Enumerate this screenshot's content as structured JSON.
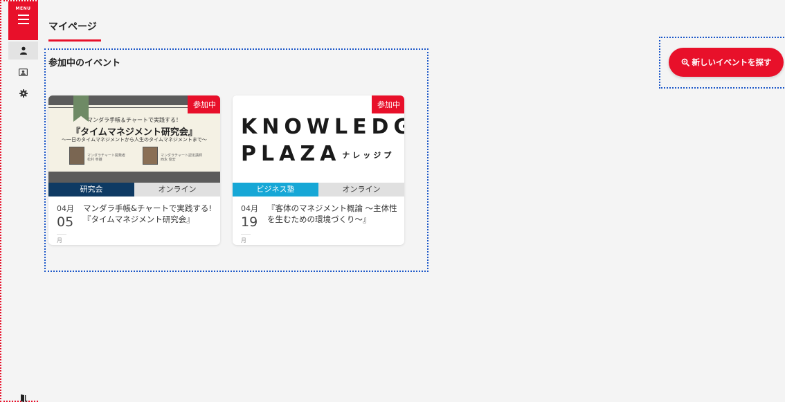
{
  "sidebar": {
    "menu_label": "MENU",
    "items": [
      {
        "icon": "user-icon"
      },
      {
        "icon": "id-card-icon"
      },
      {
        "icon": "gear-icon"
      }
    ],
    "bottom_icon": "logout-door-icon"
  },
  "header": {
    "title": "マイページ"
  },
  "events": {
    "section_title": "参加中のイベント",
    "cards": [
      {
        "badge": "参加中",
        "category": "研究会",
        "category_color": "#0e3a63",
        "format": "オンライン",
        "month": "04月",
        "day": "05",
        "day_unit": "月",
        "title": "マンダラ手帳&チャートで実践する!『タイムマネジメント研究会』",
        "thumb": {
          "line1": "マンダラ手帳＆チャートで実践する！",
          "line2": "『タイムマネジメント研究会』",
          "line3": "〜一日のタイムマネジメントから人生のタイムマネジメントまで〜",
          "caption1": "マンダラチャート開発者 松村 寧雄",
          "caption2": "マンダラチャート認定講師 西永 俊宏"
        }
      },
      {
        "badge": "参加中",
        "category": "ビジネス塾",
        "category_color": "#16a7d6",
        "format": "オンライン",
        "month": "04月",
        "day": "19",
        "day_unit": "月",
        "title": "『客体のマネジメント概論 〜主体性を生むための環境づくり〜』",
        "thumb": {
          "line1": "KNOWLEDGE",
          "line2": "PLAZA",
          "kana": "ナレッジプ"
        }
      }
    ]
  },
  "search": {
    "button_label": "新しいイベントを探す"
  },
  "colors": {
    "accent": "#e8102a",
    "focus_outline": "#1a56c8"
  }
}
